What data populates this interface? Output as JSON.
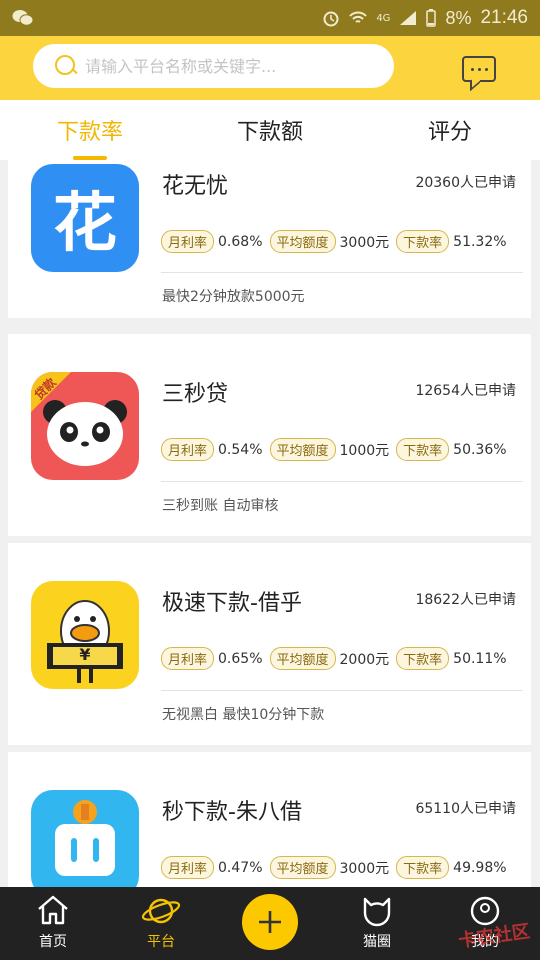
{
  "status_bar": {
    "network": "4G",
    "battery": "8%",
    "time": "21:46"
  },
  "search": {
    "placeholder": "请输入平台名称或关键字..."
  },
  "tabs": [
    {
      "label": "下款率",
      "active": true
    },
    {
      "label": "下款额",
      "active": false
    },
    {
      "label": "评分",
      "active": false
    }
  ],
  "cards": [
    {
      "name": "花无忧",
      "count": "20360人已申请",
      "rate_label": "月利率",
      "rate": "0.68%",
      "amount_label": "平均额度",
      "amount": "3000元",
      "pass_label": "下款率",
      "pass": "51.32%",
      "desc": "最快2分钟放款5000元",
      "logo_text": "花"
    },
    {
      "name": "三秒贷",
      "count": "12654人已申请",
      "rate_label": "月利率",
      "rate": "0.54%",
      "amount_label": "平均额度",
      "amount": "1000元",
      "pass_label": "下款率",
      "pass": "50.36%",
      "desc": "三秒到账 自动审核",
      "logo_text": "贷款"
    },
    {
      "name": "极速下款-借乎",
      "count": "18622人已申请",
      "rate_label": "月利率",
      "rate": "0.65%",
      "amount_label": "平均额度",
      "amount": "2000元",
      "pass_label": "下款率",
      "pass": "50.11%",
      "desc": "无视黑白 最快10分钟下款",
      "logo_text": "¥"
    },
    {
      "name": "秒下款-朱八借",
      "count": "65110人已申请",
      "rate_label": "月利率",
      "rate": "0.47%",
      "amount_label": "平均额度",
      "amount": "3000元",
      "pass_label": "下款率",
      "pass": "49.98%",
      "desc": "",
      "logo_text": ""
    }
  ],
  "nav": {
    "home": "首页",
    "platform": "平台",
    "cat": "猫圈",
    "mine": "我的"
  },
  "watermark": "卡农社区"
}
